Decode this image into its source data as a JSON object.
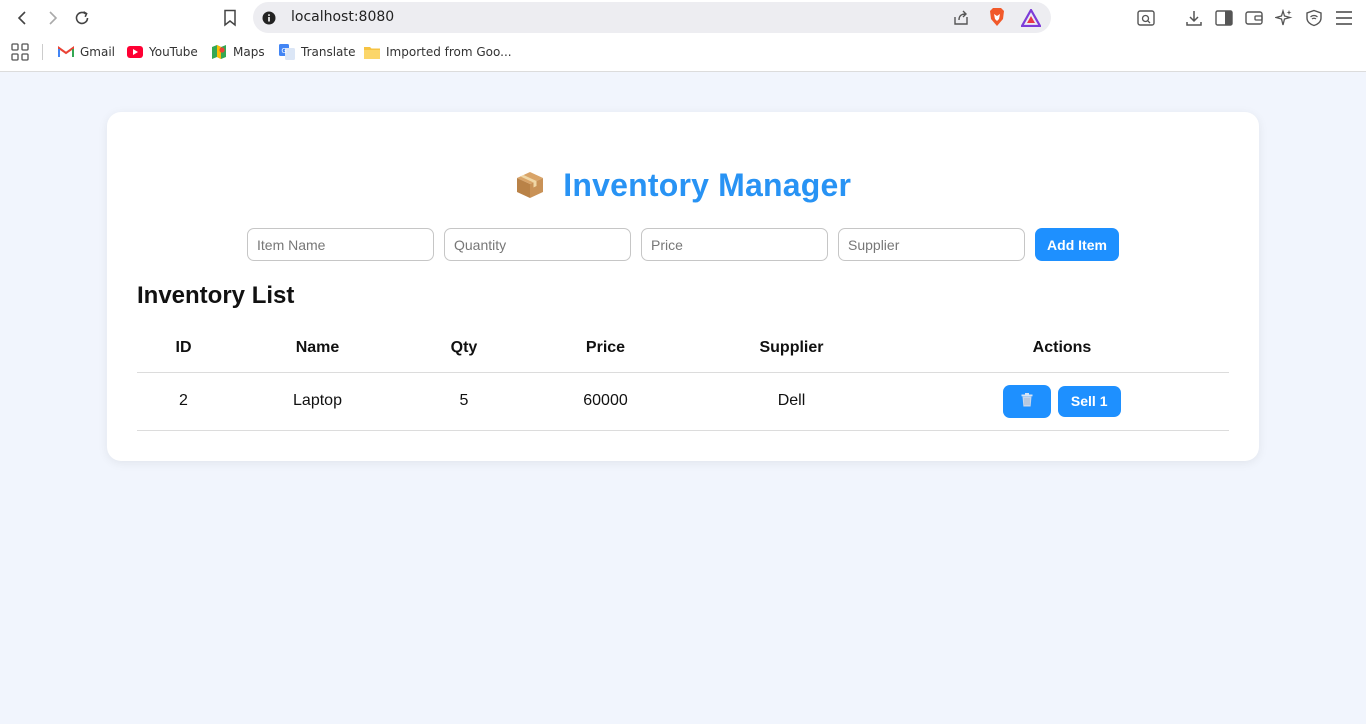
{
  "browser": {
    "url": "localhost:8080",
    "bookmarks": [
      {
        "label": "Gmail",
        "icon": "gmail-icon"
      },
      {
        "label": "YouTube",
        "icon": "youtube-icon"
      },
      {
        "label": "Maps",
        "icon": "maps-icon"
      },
      {
        "label": "Translate",
        "icon": "translate-icon"
      },
      {
        "label": "Imported from Goo...",
        "icon": "folder-icon"
      }
    ]
  },
  "app": {
    "title": "Inventory Manager",
    "title_icon": "package-icon",
    "accent_color": "#1e90ff",
    "form": {
      "name_placeholder": "Item Name",
      "qty_placeholder": "Quantity",
      "price_placeholder": "Price",
      "supplier_placeholder": "Supplier",
      "add_label": "Add Item"
    },
    "list_title": "Inventory List",
    "table": {
      "headers": [
        "ID",
        "Name",
        "Qty",
        "Price",
        "Supplier",
        "Actions"
      ],
      "rows": [
        {
          "id": "2",
          "name": "Laptop",
          "qty": "5",
          "price": "60000",
          "supplier": "Dell",
          "delete_icon": "trash-icon",
          "sell_label": "Sell 1"
        }
      ]
    }
  }
}
